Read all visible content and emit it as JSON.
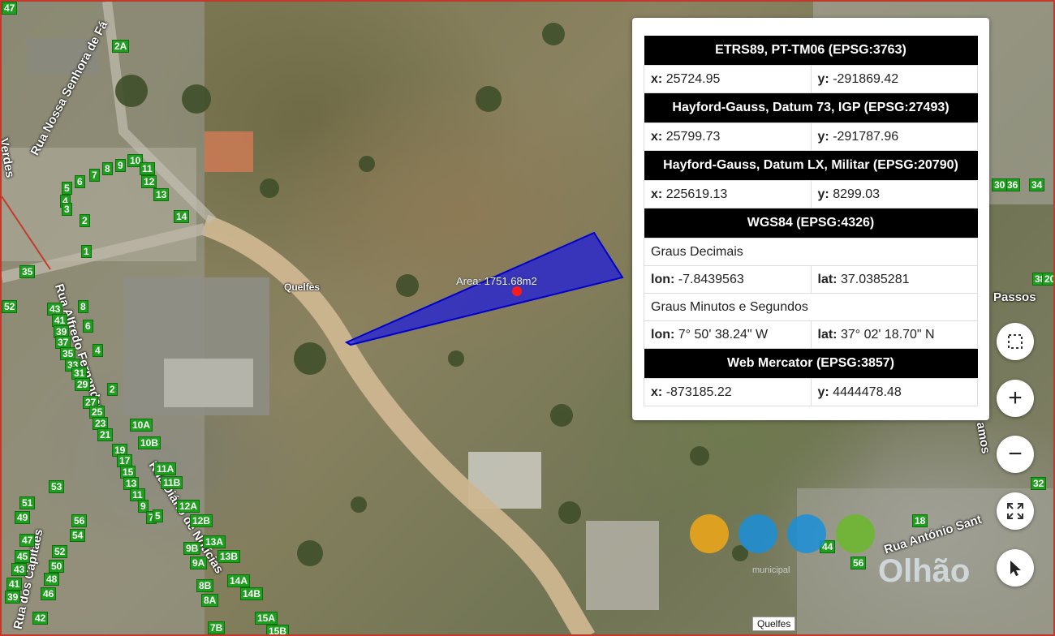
{
  "map": {
    "place_labels": {
      "quelfes": "Quelfes",
      "bottom": "Quelfes",
      "area": "Area: 1751.68m2"
    },
    "streets": {
      "senhora": "Rua Nossa Senhora de Fá",
      "verdes": "Verdes",
      "alfredo": "Rua Alfredo Fernandes",
      "diario": "Rua Diário de Notícias",
      "capitaes": "Rua dos Capitães",
      "antonio": "Rua António Sant",
      "passos": "Passos",
      "ramos": "amos"
    },
    "house_numbers": [
      "2A",
      "4",
      "5",
      "6",
      "7",
      "8",
      "9",
      "10",
      "11",
      "12",
      "13",
      "14",
      "3",
      "2",
      "1",
      "35",
      "52",
      "43",
      "41",
      "39",
      "37",
      "35",
      "33",
      "31",
      "29",
      "27",
      "25",
      "23",
      "21",
      "19",
      "17",
      "15",
      "13",
      "11",
      "9",
      "7",
      "5",
      "8",
      "6",
      "4",
      "2",
      "10A",
      "10B",
      "11A",
      "11B",
      "12A",
      "12B",
      "13A",
      "13B",
      "9B",
      "9A",
      "8B",
      "8A",
      "14A",
      "14B",
      "15A",
      "15B",
      "7B",
      "53",
      "51",
      "49",
      "47",
      "45",
      "43",
      "41",
      "39",
      "42",
      "46",
      "48",
      "50",
      "52",
      "54",
      "56",
      "36",
      "34",
      "32",
      "30",
      "38",
      "20",
      "18",
      "44",
      "56",
      "47"
    ],
    "polygon_color": "#0000cc",
    "marker_color": "#ff0000"
  },
  "info_panel": {
    "sections": [
      {
        "title": "ETRS89, PT-TM06 (EPSG:3763)",
        "x_label": "x:",
        "x": "25724.95",
        "y_label": "y:",
        "y": "-291869.42"
      },
      {
        "title": "Hayford-Gauss, Datum 73, IGP (EPSG:27493)",
        "x_label": "x:",
        "x": "25799.73",
        "y_label": "y:",
        "y": "-291787.96"
      },
      {
        "title": "Hayford-Gauss, Datum LX, Militar (EPSG:20790)",
        "x_label": "x:",
        "x": "225619.13",
        "y_label": "y:",
        "y": "8299.03"
      }
    ],
    "wgs84": {
      "title": "WGS84 (EPSG:4326)",
      "decimal_heading": "Graus Decimais",
      "lon_label": "lon:",
      "lon_dec": "-7.8439563",
      "lat_label": "lat:",
      "lat_dec": "37.0385281",
      "dms_heading": "Graus Minutos e Segundos",
      "lon_dms": "7° 50' 38.24\" W",
      "lat_dms": "37° 02' 18.70\" N"
    },
    "mercator": {
      "title": "Web Mercator (EPSG:3857)",
      "x_label": "x:",
      "x": "-873185.22",
      "y_label": "y:",
      "y": "4444478.48"
    }
  },
  "controls": {
    "select_area_icon": "dashed-square-icon",
    "zoom_in": "+",
    "zoom_out": "−",
    "fullscreen_icon": "expand-icon",
    "pointer_icon": "cursor-icon"
  },
  "logo": {
    "text": "Olhão",
    "sub": "municipal"
  }
}
